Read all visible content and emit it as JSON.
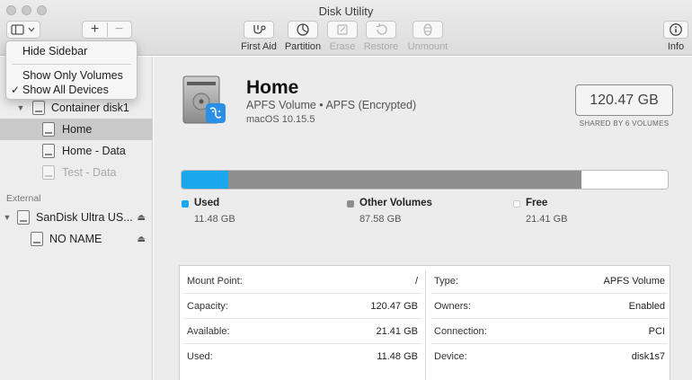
{
  "window": {
    "title": "Disk Utility"
  },
  "toolbar": {
    "plus": "+",
    "minus": "−",
    "first_aid": "First Aid",
    "partition": "Partition",
    "erase": "Erase",
    "restore": "Restore",
    "unmount": "Unmount",
    "info": "Info"
  },
  "menu": {
    "hide_sidebar": "Hide Sidebar",
    "show_only_volumes": "Show Only Volumes",
    "show_all_devices": "Show All Devices",
    "checkmark": "✓"
  },
  "sidebar": {
    "container": "Container disk1",
    "home": "Home",
    "home_data": "Home - Data",
    "test_data": "Test - Data",
    "external_header": "External",
    "sandisk": "SanDisk Ultra US...",
    "no_name": "NO NAME"
  },
  "volume": {
    "name": "Home",
    "subtitle": "APFS Volume • APFS (Encrypted)",
    "os": "macOS 10.15.5",
    "capacity": "120.47 GB",
    "shared": "SHARED BY 6 VOLUMES"
  },
  "usage": {
    "used_fraction": 0.0953,
    "other_fraction": 0.7269,
    "used_label": "Used",
    "used_value": "11.48 GB",
    "other_label": "Other Volumes",
    "other_value": "87.58 GB",
    "free_label": "Free",
    "free_value": "21.41 GB"
  },
  "info": {
    "mount_point_label": "Mount Point:",
    "mount_point": "/",
    "capacity_label": "Capacity:",
    "capacity": "120.47 GB",
    "available_label": "Available:",
    "available": "21.41 GB",
    "used_label": "Used:",
    "used": "11.48 GB",
    "type_label": "Type:",
    "type": "APFS Volume",
    "owners_label": "Owners:",
    "owners": "Enabled",
    "connection_label": "Connection:",
    "connection": "PCI",
    "device_label": "Device:",
    "device": "disk1s7"
  },
  "colors": {
    "used": "#1aa7ec",
    "other": "#8e8e8e",
    "free": "#ffffff",
    "selection": "#c9c9c9"
  }
}
